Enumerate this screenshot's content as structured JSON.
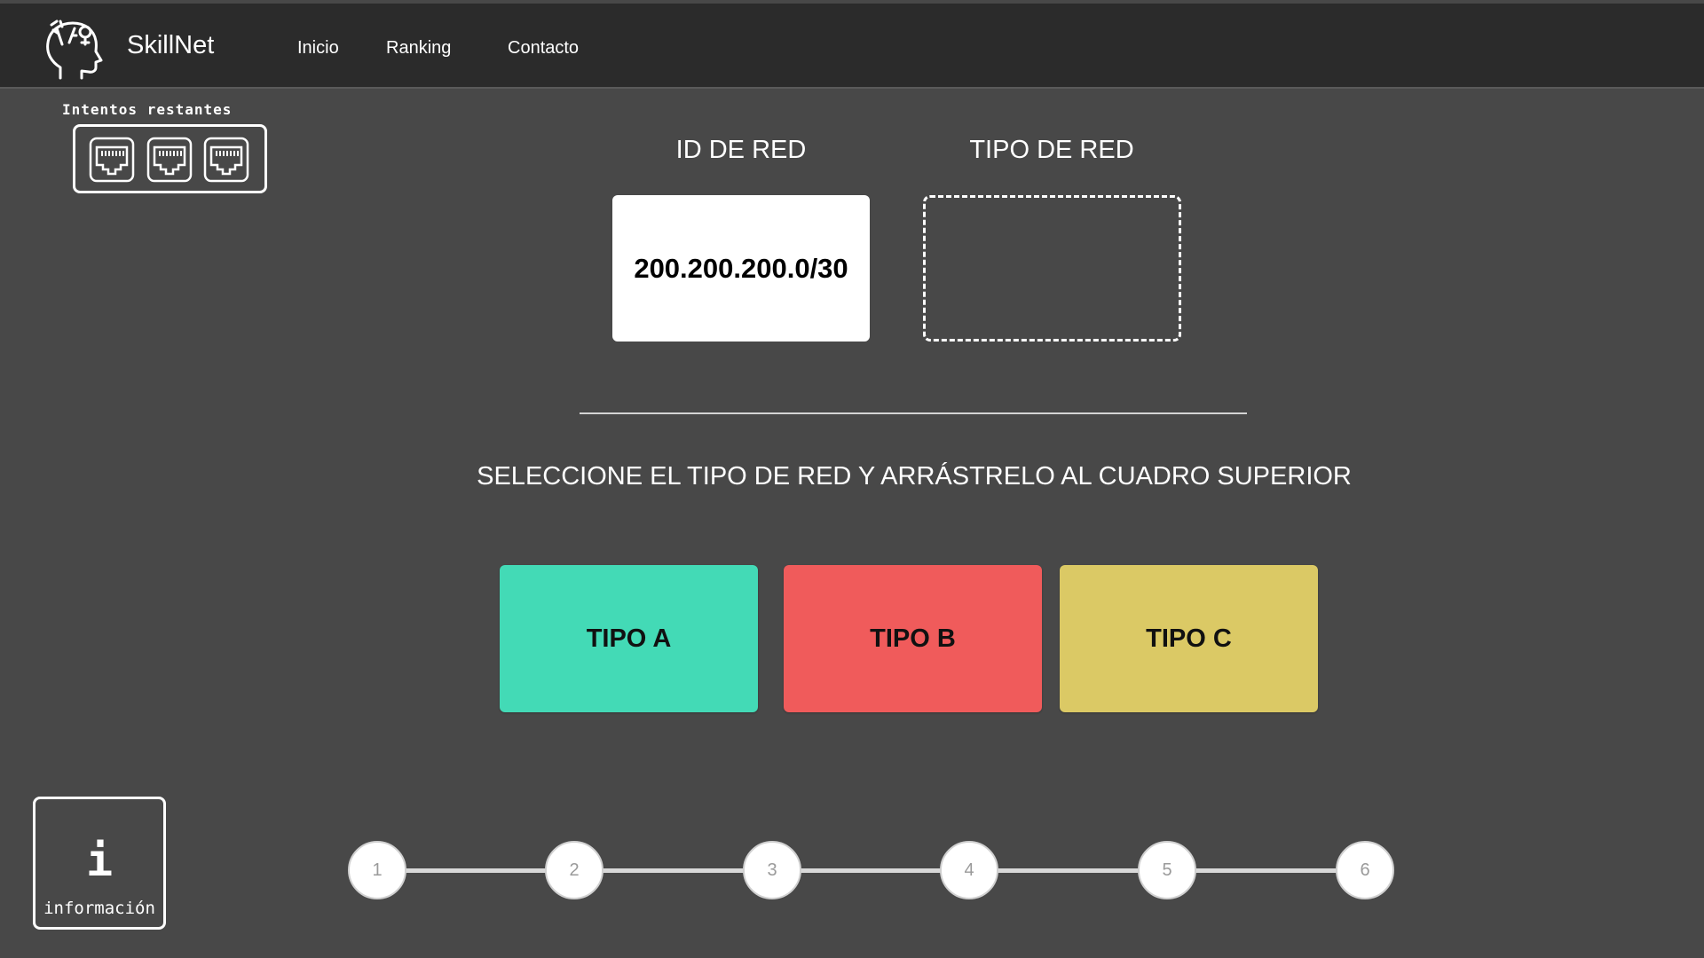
{
  "app": {
    "brand_name": "SkillNet"
  },
  "nav": {
    "items": [
      {
        "label": "Inicio"
      },
      {
        "label": "Ranking"
      },
      {
        "label": "Contacto"
      }
    ]
  },
  "attempts": {
    "label": "Intentos restantes",
    "remaining": 3,
    "icon": "ethernet-port-icon"
  },
  "network": {
    "id_label": "ID DE RED",
    "id_value": "200.200.200.0/30",
    "type_label": "TIPO DE RED",
    "type_value": ""
  },
  "instruction": "SELECCIONE EL TIPO DE RED Y ARRÁSTRELO AL CUADRO SUPERIOR",
  "types": [
    {
      "label": "TIPO A",
      "color": "#43dab6"
    },
    {
      "label": "TIPO B",
      "color": "#f05b5b"
    },
    {
      "label": "TIPO C",
      "color": "#dbc965"
    }
  ],
  "info": {
    "icon_glyph": "i",
    "label": "información"
  },
  "steps": [
    "1",
    "2",
    "3",
    "4",
    "5",
    "6"
  ]
}
